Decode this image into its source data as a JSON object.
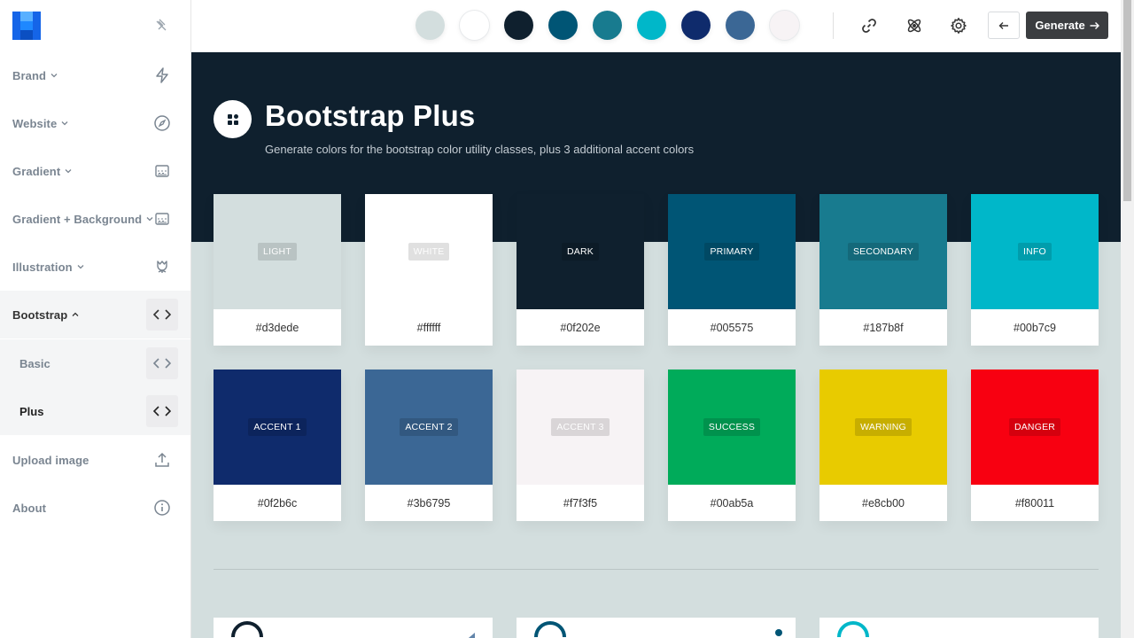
{
  "sidebar": {
    "items": [
      {
        "label": "Brand",
        "icon": "bolt-icon"
      },
      {
        "label": "Website",
        "icon": "compass-icon"
      },
      {
        "label": "Gradient",
        "icon": "gradient-icon"
      },
      {
        "label": "Gradient + Background",
        "icon": "gradient-icon"
      },
      {
        "label": "Illustration",
        "icon": "flower-icon"
      },
      {
        "label": "Bootstrap",
        "icon": "code-icon"
      }
    ],
    "sub_items": [
      {
        "label": "Basic",
        "icon": "code-icon"
      },
      {
        "label": "Plus",
        "icon": "code-icon"
      }
    ],
    "bottom_items": [
      {
        "label": "Upload image",
        "icon": "upload-icon"
      },
      {
        "label": "About",
        "icon": "info-icon"
      }
    ]
  },
  "topbar": {
    "palette_dots": [
      "#d3dede",
      "#ffffff",
      "#0f202e",
      "#005575",
      "#187b8f",
      "#00b7c9",
      "#0f2b6c",
      "#3b6795",
      "#f7f3f5"
    ],
    "generate_label": "Generate"
  },
  "hero": {
    "title": "Bootstrap Plus",
    "subtitle": "Generate colors for the bootstrap color utility classes, plus 3 additional accent colors"
  },
  "colors": [
    {
      "name": "LIGHT",
      "hex": "#d3dede",
      "text_dark": false
    },
    {
      "name": "WHITE",
      "hex": "#ffffff",
      "text_dark": false
    },
    {
      "name": "DARK",
      "hex": "#0f202e",
      "text_dark": false
    },
    {
      "name": "PRIMARY",
      "hex": "#005575",
      "text_dark": false
    },
    {
      "name": "SECONDARY",
      "hex": "#187b8f",
      "text_dark": false
    },
    {
      "name": "INFO",
      "hex": "#00b7c9",
      "text_dark": false
    },
    {
      "name": "ACCENT 1",
      "hex": "#0f2b6c",
      "text_dark": false
    },
    {
      "name": "ACCENT 2",
      "hex": "#3b6795",
      "text_dark": false
    },
    {
      "name": "ACCENT 3",
      "hex": "#f7f3f5",
      "text_dark": false
    },
    {
      "name": "SUCCESS",
      "hex": "#00ab5a",
      "text_dark": false
    },
    {
      "name": "WARNING",
      "hex": "#e8cb00",
      "text_dark": false
    },
    {
      "name": "DANGER",
      "hex": "#f80011",
      "text_dark": false
    }
  ]
}
